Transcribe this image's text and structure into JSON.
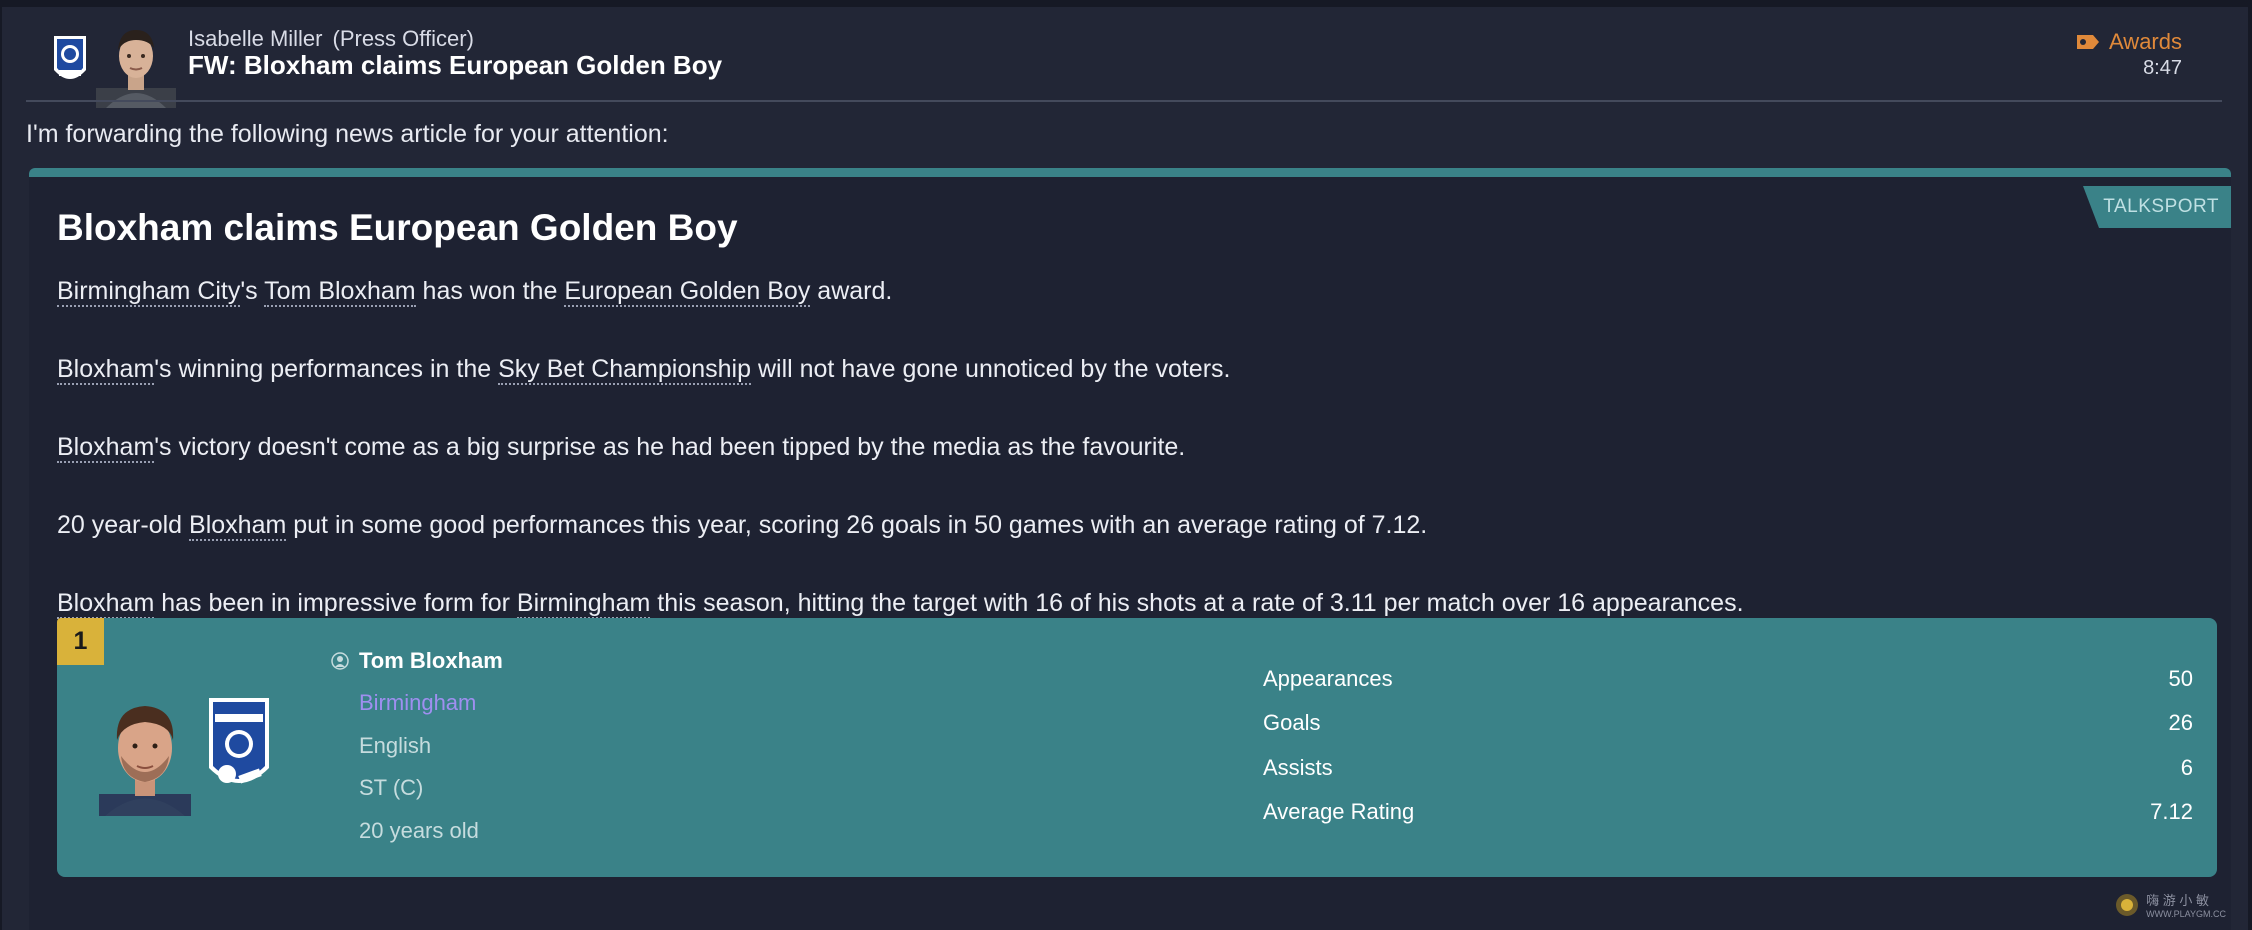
{
  "header": {
    "sender_name": "Isabelle Miller",
    "sender_role": "(Press Officer)",
    "subject": "FW: Bloxham claims European Golden Boy",
    "category": "Awards",
    "time": "8:47"
  },
  "intro": "I'm forwarding the following news article for your attention:",
  "article": {
    "source": "TALKSPORT",
    "title": "Bloxham claims European Golden Boy",
    "p1": {
      "club_link": "Birmingham City",
      "t1": "'s ",
      "player_link": "Tom Bloxham",
      "t2": " has won the ",
      "award_link": "European Golden Boy",
      "t3": " award."
    },
    "p2": {
      "player_link": "Bloxham",
      "t1": "'s winning performances in the ",
      "league_link": "Sky Bet Championship",
      "t2": " will not have gone unnoticed by the voters."
    },
    "p3": {
      "player_link": "Bloxham",
      "t1": "'s victory doesn't come as a big surprise as he had been tipped by the media as the favourite."
    },
    "p4": {
      "t0": "20 year-old ",
      "player_link": "Bloxham",
      "t1": " put in some good performances this year, scoring 26 goals in 50 games with an average rating of 7.12."
    },
    "p5": {
      "player_link": "Bloxham",
      "t1": " has been in impressive form for ",
      "club_link": "Birmingham",
      "t2": " this season, hitting the target with 16 of his shots at a rate of 3.11 per match over 16 appearances."
    }
  },
  "player_card": {
    "rank": "1",
    "name": "Tom Bloxham",
    "club": "Birmingham",
    "nationality": "English",
    "position": "ST (C)",
    "age": "20 years old",
    "stats": [
      {
        "label": "Appearances",
        "value": "50"
      },
      {
        "label": "Goals",
        "value": "26"
      },
      {
        "label": "Assists",
        "value": "6"
      },
      {
        "label": "Average Rating",
        "value": "7.12"
      }
    ]
  },
  "watermark": {
    "line1": "嗨 游 小 敏",
    "line2": "WWW.PLAYGM.CC"
  },
  "colors": {
    "background": "#222636",
    "accent_teal": "#3a8288",
    "category_orange": "#e0893a",
    "rank_gold": "#d9b23a",
    "club_link_purple": "#9f8ff0"
  },
  "icons": {
    "category": "tag-icon",
    "player": "person-icon",
    "club": "club-crest-icon"
  }
}
